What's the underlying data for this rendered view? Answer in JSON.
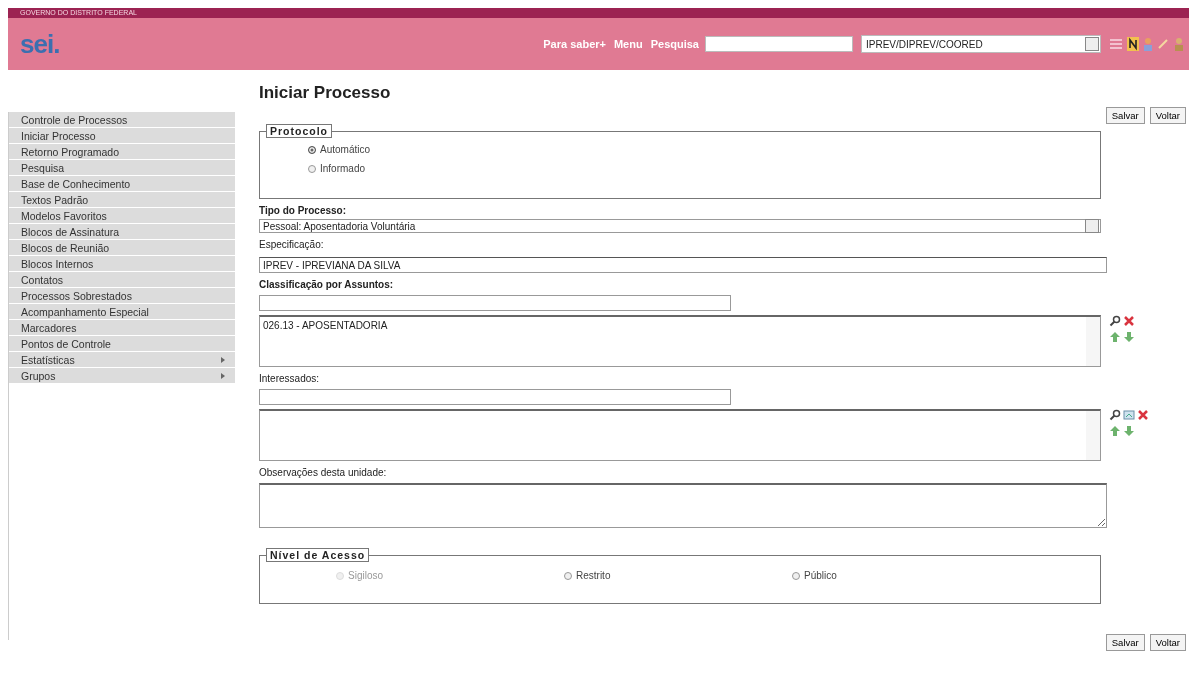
{
  "header": {
    "government": "GOVERNO DO DISTRITO FEDERAL",
    "logo": "sei.",
    "links": [
      "Para saber+",
      "Menu",
      "Pesquisa"
    ],
    "unit_select": {
      "value": "IPREV/DIPREV/COORED"
    }
  },
  "sidebar": {
    "items": [
      {
        "label": "Controle de Processos",
        "submenu": false
      },
      {
        "label": "Iniciar Processo",
        "submenu": false
      },
      {
        "label": "Retorno Programado",
        "submenu": false
      },
      {
        "label": "Pesquisa",
        "submenu": false
      },
      {
        "label": "Base de Conhecimento",
        "submenu": false
      },
      {
        "label": "Textos Padrão",
        "submenu": false
      },
      {
        "label": "Modelos Favoritos",
        "submenu": false
      },
      {
        "label": "Blocos de Assinatura",
        "submenu": false
      },
      {
        "label": "Blocos de Reunião",
        "submenu": false
      },
      {
        "label": "Blocos Internos",
        "submenu": false
      },
      {
        "label": "Contatos",
        "submenu": false
      },
      {
        "label": "Processos Sobrestados",
        "submenu": false
      },
      {
        "label": "Acompanhamento Especial",
        "submenu": false
      },
      {
        "label": "Marcadores",
        "submenu": false
      },
      {
        "label": "Pontos de Controle",
        "submenu": false
      },
      {
        "label": "Estatísticas",
        "submenu": true
      },
      {
        "label": "Grupos",
        "submenu": true
      }
    ]
  },
  "title": "Iniciar Processo",
  "top_buttons": [
    "Salvar",
    "Voltar"
  ],
  "protocolo": {
    "legend": "Protocolo",
    "options": [
      {
        "label": "Automático",
        "selected": true
      },
      {
        "label": "Informado",
        "selected": false
      }
    ]
  },
  "tipo": {
    "label": "Tipo do Processo:",
    "required": true,
    "value": "Pessoal: Aposentadoria Voluntária"
  },
  "especificacao": {
    "label": "Especificação:",
    "required": false,
    "value": "IPREV - IPREVIANA DA SILVA"
  },
  "classificacao": {
    "label": "Classificação por Assuntos:",
    "required": true,
    "items": [
      "026.13 - APOSENTADORIA"
    ]
  },
  "interessados": {
    "label": "Interessados:",
    "required": false
  },
  "observacoes": {
    "label": "Observações desta unidade:",
    "required": false
  },
  "nivel_acesso": {
    "legend": "Nível de Acesso",
    "options": [
      {
        "label": "Sigiloso",
        "selected": false,
        "disabled": true
      },
      {
        "label": "Restrito",
        "selected": false,
        "disabled": false
      },
      {
        "label": "Público",
        "selected": false,
        "disabled": false
      }
    ]
  },
  "bottom_buttons": [
    "Salvar",
    "Voltar"
  ]
}
